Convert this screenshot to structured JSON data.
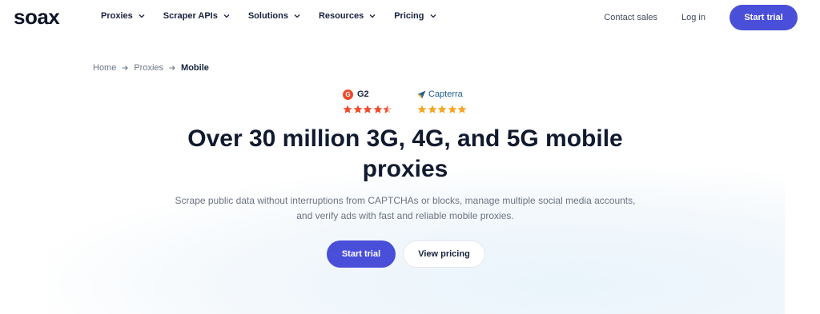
{
  "header": {
    "logo": "soax",
    "nav": [
      {
        "label": "Proxies"
      },
      {
        "label": "Scraper APIs"
      },
      {
        "label": "Solutions"
      },
      {
        "label": "Resources"
      },
      {
        "label": "Pricing"
      }
    ],
    "contact_sales": "Contact sales",
    "login": "Log in",
    "start_trial": "Start trial"
  },
  "breadcrumb": [
    "Home",
    "Proxies",
    "Mobile"
  ],
  "ratings": {
    "g2": {
      "name": "G2",
      "badge": "G",
      "stars": 4.5,
      "color": "#ef4a2c"
    },
    "capterra": {
      "name": "Capterra",
      "stars": 5,
      "color": "#f5a623"
    }
  },
  "hero": {
    "title_line1": "Over 30 million 3G, 4G, and 5G mobile",
    "title_line2": "proxies",
    "subtitle_line1": "Scrape public data without interruptions from CAPTCHAs or blocks, manage multiple social media accounts,",
    "subtitle_line2": "and verify ads with fast and reliable mobile proxies.",
    "primary_cta": "Start trial",
    "secondary_cta": "View pricing"
  },
  "colors": {
    "accent": "#4a4fd9",
    "text_dark": "#111a2e",
    "text_muted": "#6b7384"
  },
  "icons": {
    "nav_chevron": "chevron-down-icon",
    "breadcrumb_separator": "arrow-right-icon",
    "star": "star-icon",
    "capterra_logo": "capterra-arrow-icon"
  }
}
